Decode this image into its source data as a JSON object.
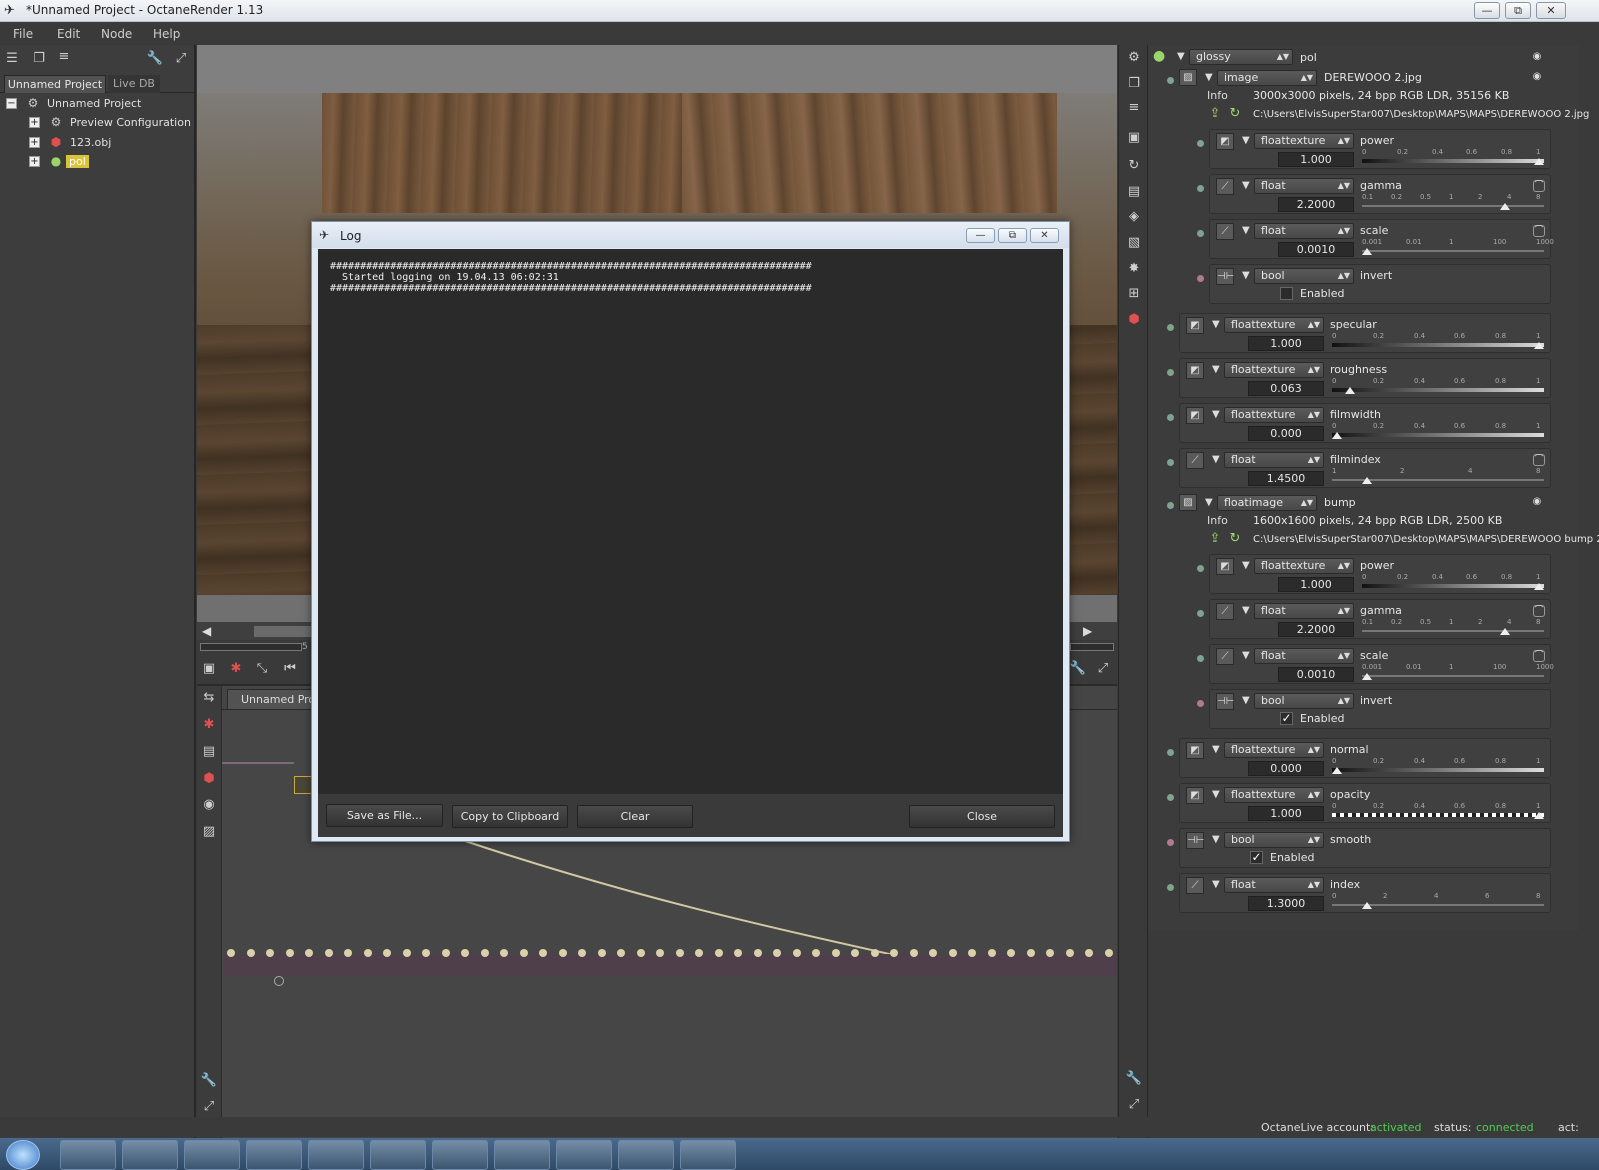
{
  "window": {
    "title": "*Unnamed Project - OctaneRender 1.13",
    "minimize_glyph": "—",
    "restore_glyph": "⧉",
    "close_glyph": "✕"
  },
  "menu": {
    "file": "File",
    "edit": "Edit",
    "node": "Node",
    "help": "Help"
  },
  "left_panel": {
    "tabs": {
      "project": "Unnamed Project",
      "livedb": "Live DB"
    },
    "tree": {
      "root": "Unnamed Project",
      "preview": "Preview Configuration",
      "obj": "123.obj",
      "material": "pol"
    }
  },
  "viewport": {
    "progress_text": "5"
  },
  "nodegraph": {
    "tab_label": "Unnamed Project"
  },
  "log_dialog": {
    "title": "Log",
    "log_lines": [
      "################################################################################",
      "  Started logging on 19.04.13 06:02:31",
      "################################################################################"
    ],
    "buttons": {
      "save": "Save as File...",
      "copy": "Copy to Clipboard",
      "clear": "Clear",
      "close": "Close"
    }
  },
  "inspector": {
    "header": {
      "type": "glossy",
      "name": "pol"
    },
    "diffuse": {
      "type": "image",
      "name": "DEREWOOO 2.jpg",
      "info_label": "Info",
      "info": "3000x3000 pixels, 24 bpp RGB LDR, 35156 KB",
      "path": "C:\\Users\\ElvisSuperStar007\\Desktop\\MAPS\\MAPS\\DEREWOOO 2.jpg",
      "power": {
        "type": "floattexture",
        "name": "power",
        "value": "1.000",
        "ticks": [
          "0",
          "0.2",
          "0.4",
          "0.6",
          "0.8",
          "1"
        ],
        "level": 1.0
      },
      "gamma": {
        "type": "float",
        "name": "gamma",
        "value": "2.2000",
        "ticks": [
          "0.1",
          "0.2",
          "0.5",
          "1",
          "2",
          "4",
          "8"
        ]
      },
      "scale": {
        "type": "float",
        "name": "scale",
        "value": "0.0010",
        "ticks": [
          "0.001",
          "0.01",
          "1",
          "100",
          "1000"
        ]
      },
      "invert": {
        "type": "bool",
        "name": "invert",
        "label": "Enabled",
        "checked": false
      }
    },
    "specular": {
      "type": "floattexture",
      "name": "specular",
      "value": "1.000",
      "ticks": [
        "0",
        "0.2",
        "0.4",
        "0.6",
        "0.8",
        "1"
      ],
      "level": 1.0
    },
    "roughness": {
      "type": "floattexture",
      "name": "roughness",
      "value": "0.063",
      "ticks": [
        "0",
        "0.2",
        "0.4",
        "0.6",
        "0.8",
        "1"
      ],
      "level": 0.063
    },
    "filmwidth": {
      "type": "floattexture",
      "name": "filmwidth",
      "value": "0.000",
      "ticks": [
        "0",
        "0.2",
        "0.4",
        "0.6",
        "0.8",
        "1"
      ],
      "level": 0.0
    },
    "filmindex": {
      "type": "float",
      "name": "filmindex",
      "value": "1.4500",
      "ticks": [
        "1",
        "2",
        "4",
        "8"
      ]
    },
    "bump": {
      "type": "floatimage",
      "name": "bump",
      "info_label": "Info",
      "info": "1600x1600 pixels, 24 bpp RGB LDR, 2500 KB",
      "path": "C:\\Users\\ElvisSuperStar007\\Desktop\\MAPS\\MAPS\\DEREWOOO bump 2.jpg",
      "power": {
        "type": "floattexture",
        "name": "power",
        "value": "1.000",
        "ticks": [
          "0",
          "0.2",
          "0.4",
          "0.6",
          "0.8",
          "1"
        ],
        "level": 1.0
      },
      "gamma": {
        "type": "float",
        "name": "gamma",
        "value": "2.2000",
        "ticks": [
          "0.1",
          "0.2",
          "0.5",
          "1",
          "2",
          "4",
          "8"
        ]
      },
      "scale": {
        "type": "float",
        "name": "scale",
        "value": "0.0010",
        "ticks": [
          "0.001",
          "0.01",
          "1",
          "100",
          "1000"
        ]
      },
      "invert": {
        "type": "bool",
        "name": "invert",
        "label": "Enabled",
        "checked": true
      }
    },
    "normal": {
      "type": "floattexture",
      "name": "normal",
      "value": "0.000",
      "ticks": [
        "0",
        "0.2",
        "0.4",
        "0.6",
        "0.8",
        "1"
      ],
      "level": 0.0
    },
    "opacity": {
      "type": "floattexture",
      "name": "opacity",
      "value": "1.000",
      "ticks": [
        "0",
        "0.2",
        "0.4",
        "0.6",
        "0.8",
        "1"
      ],
      "level": 1.0
    },
    "smooth": {
      "type": "bool",
      "name": "smooth",
      "label": "Enabled",
      "checked": true
    },
    "index": {
      "type": "float",
      "name": "index",
      "value": "1.3000",
      "ticks": [
        "0",
        "2",
        "4",
        "6",
        "8"
      ]
    }
  },
  "statusbar": {
    "account_label": "OctaneLive account:",
    "account_value": "activated",
    "status_label": "status:",
    "status_value": "connected",
    "act_label": "act:"
  },
  "colors": {
    "accent_green": "#4cd04c",
    "selection_yellow": "#d9c33a"
  }
}
